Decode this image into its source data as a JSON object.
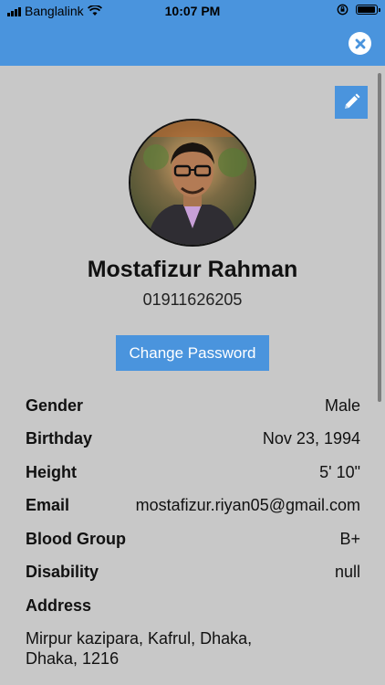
{
  "status_bar": {
    "carrier": "Banglalink",
    "time": "10:07 PM",
    "icons": [
      "signal-icon",
      "wifi-icon",
      "rotation-lock-icon",
      "battery-icon"
    ]
  },
  "header": {
    "close_icon": "close-icon"
  },
  "toolbar": {
    "edit_icon": "pencil-icon"
  },
  "profile": {
    "name": "Mostafizur Rahman",
    "phone": "01911626205",
    "change_password_label": "Change Password"
  },
  "details": [
    {
      "label": "Gender",
      "value": "Male"
    },
    {
      "label": "Birthday",
      "value": "Nov 23, 1994"
    },
    {
      "label": "Height",
      "value": "5' 10\""
    },
    {
      "label": "Email",
      "value": "mostafizur.riyan05@gmail.com"
    },
    {
      "label": "Blood Group",
      "value": "B+"
    },
    {
      "label": "Disability",
      "value": "null"
    },
    {
      "label": "Address",
      "value": ""
    }
  ],
  "address": {
    "line1": "Mirpur kazipara, Kafrul, Dhaka,",
    "line2": "Dhaka, 1216"
  },
  "colors": {
    "accent": "#4a94dd",
    "background": "#c8c8c8"
  }
}
